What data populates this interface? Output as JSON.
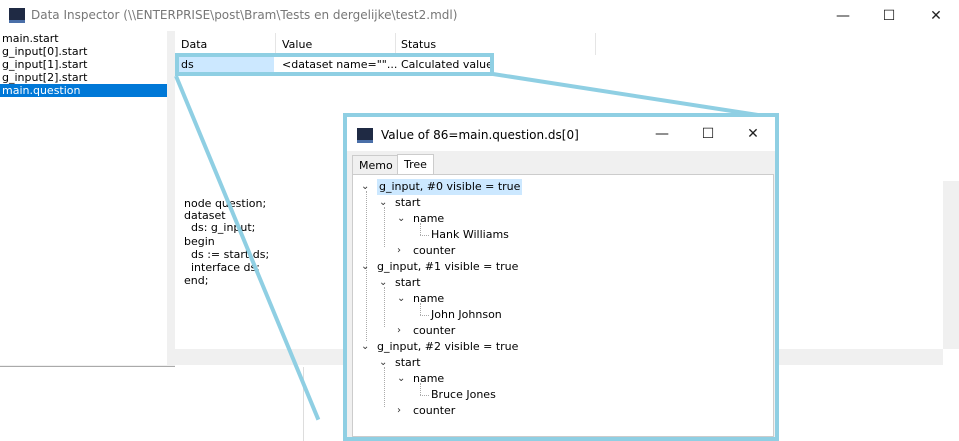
{
  "main_window": {
    "title": "Data Inspector  (\\\\ENTERPRISE\\post\\Bram\\Tests en dergelijke\\test2.mdl)",
    "controls": {
      "minimize": "—",
      "maximize": "☐",
      "close": "✕"
    }
  },
  "vars": [
    "main.start",
    "g_input[0].start",
    "g_input[1].start",
    "g_input[2].start",
    "main.question"
  ],
  "selected_var": "main.question",
  "grid": {
    "columns": [
      "Data",
      "Value",
      "Status"
    ],
    "rows": [
      {
        "data": "ds",
        "value": "<dataset name=\"\"...",
        "status": "Calculated value"
      }
    ]
  },
  "memo": {
    "lines": [
      "node question;",
      "dataset",
      "  ds: g_input;",
      "begin",
      "  ds := start.ds;",
      "  interface ds;",
      "end;"
    ]
  },
  "popup": {
    "title": "Value of 86=main.question.ds[0]",
    "tabs": [
      "Memo",
      "Tree"
    ],
    "active_tab": "Tree",
    "tree": [
      {
        "label": "g_input, #0 visible = true",
        "start": "start",
        "name": "name",
        "value": "Hank Williams",
        "counter": "counter"
      },
      {
        "label": "g_input, #1 visible = true",
        "start": "start",
        "name": "name",
        "value": "John Johnson",
        "counter": "counter"
      },
      {
        "label": "g_input, #2 visible = true",
        "start": "start",
        "name": "name",
        "value": "Bruce Jones",
        "counter": "counter"
      }
    ]
  },
  "colors": {
    "selection": "#0078d7",
    "tree_selection": "#cce8ff",
    "callout": "#8fcfe3",
    "row_highlight": "#cce8ff"
  }
}
